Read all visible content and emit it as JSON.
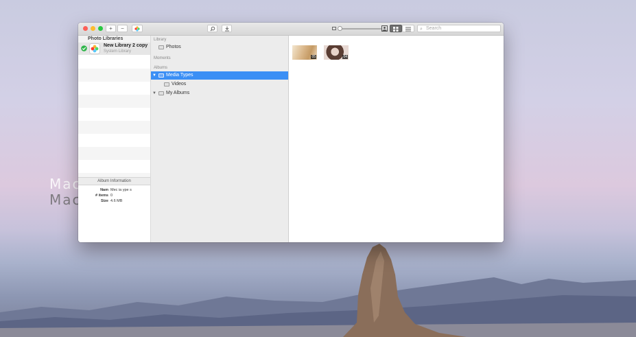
{
  "watermark": {
    "line1": "Mac",
    "line2": "Macv.com"
  },
  "window": {
    "traffic_lights": [
      "#fc5f57",
      "#fdbc2e",
      "#28c840"
    ],
    "toolbar": {
      "add_label": "+",
      "remove_label": "−",
      "search_placeholder": "Search"
    },
    "libraries_panel": {
      "header": "Photo Libraries",
      "library": {
        "name": "New Library 2 copy",
        "subtitle": "System Library"
      },
      "album_info_header": "Album Information",
      "info_rows": [
        {
          "key": "Nam",
          "value": "Mec ia ype s"
        },
        {
          "key": "# items",
          "value": "0"
        },
        {
          "key": "Size",
          "value": "4.6 MB"
        }
      ]
    },
    "source_list": {
      "library_section": "Library",
      "photos_label": "Photos",
      "moments_section": "Moments",
      "albums_section": "Albums",
      "media_types_label": "Media Types",
      "videos_label": "Videos",
      "my_albums_label": "My Albums"
    },
    "grid": {
      "items": [
        {
          "duration": "05",
          "colors": [
            "#d8b486",
            "#f2e1c6"
          ]
        },
        {
          "duration": "04",
          "colors": [
            "#5a3d33",
            "#e7d8d2"
          ]
        }
      ]
    }
  }
}
